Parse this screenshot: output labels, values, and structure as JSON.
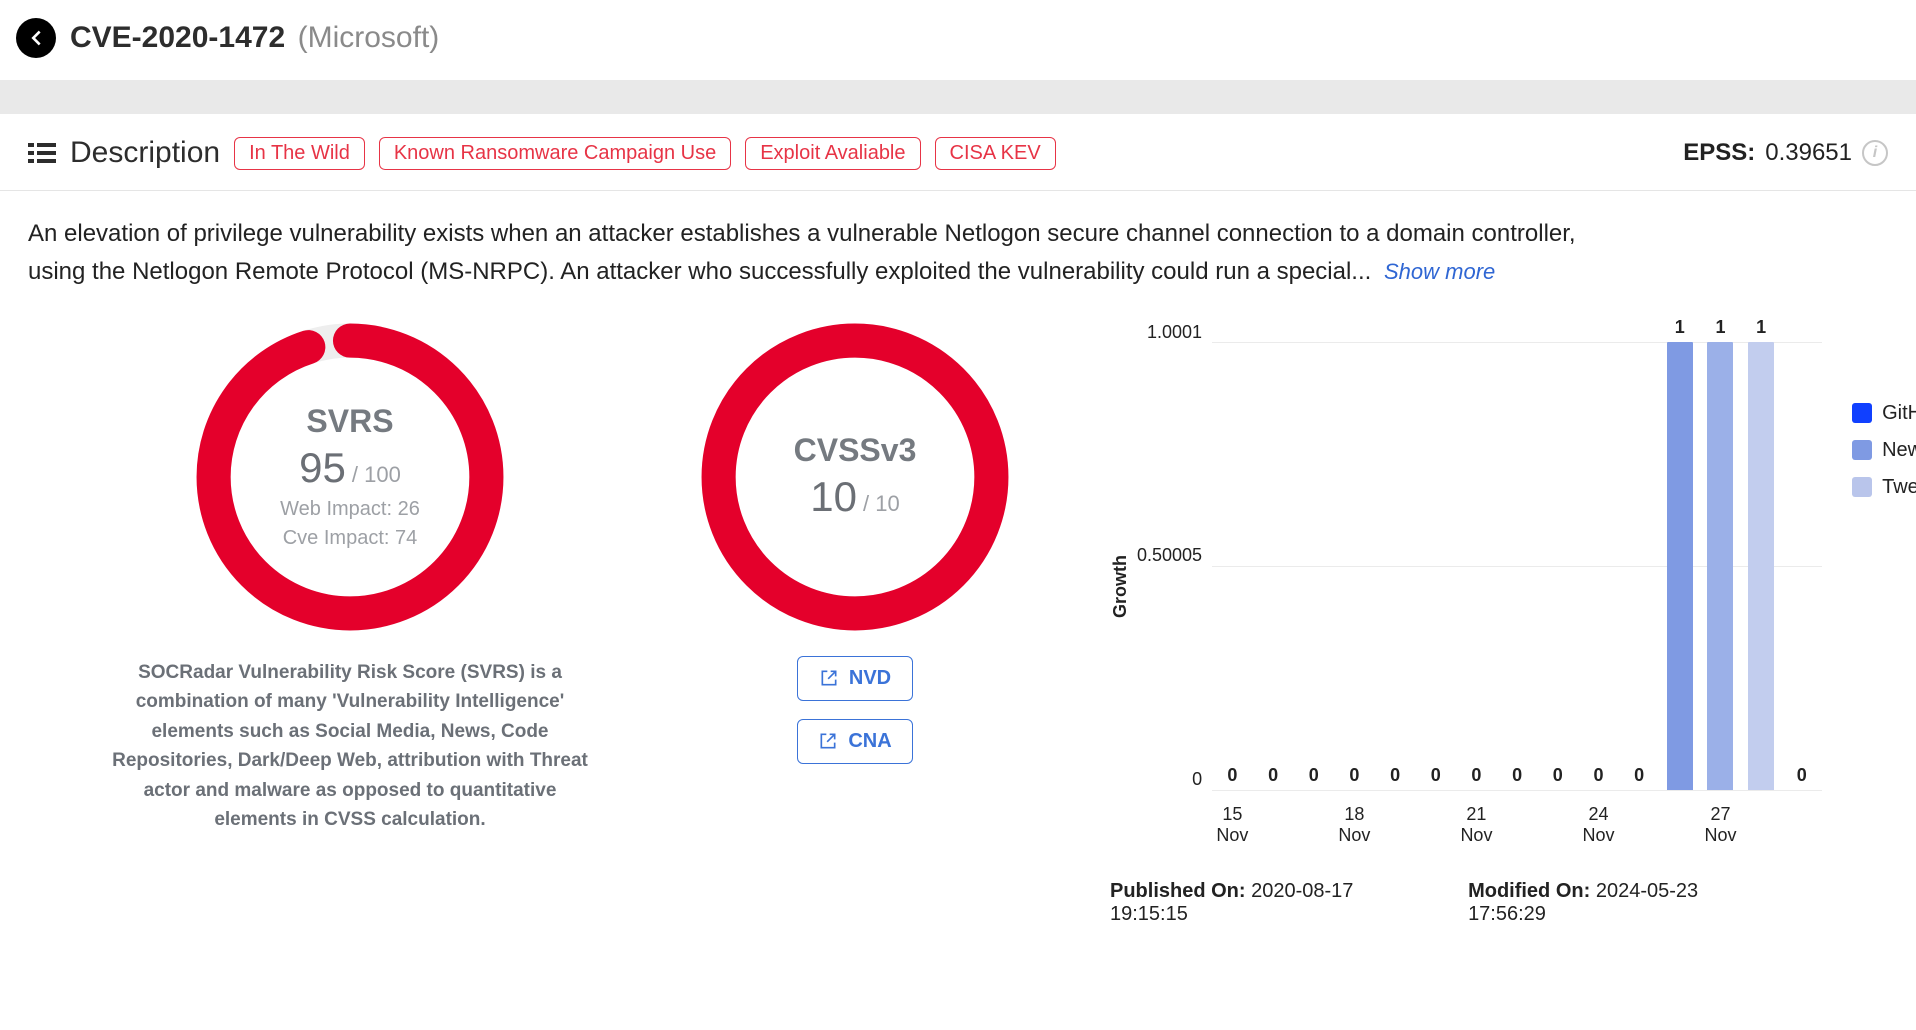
{
  "header": {
    "cve_id": "CVE-2020-1472",
    "vendor": "(Microsoft)"
  },
  "description_row": {
    "label": "Description",
    "tags": [
      "In The Wild",
      "Known Ransomware Campaign Use",
      "Exploit Avaliable",
      "CISA KEV"
    ],
    "epss_label": "EPSS:",
    "epss_value": "0.39651"
  },
  "description_text": "An elevation of privilege vulnerability exists when an attacker establishes a vulnerable Netlogon secure channel connection to a domain controller, using the Netlogon Remote Protocol (MS-NRPC). An attacker who successfully exploited the vulnerability could run a special...",
  "show_more_label": "Show more",
  "gauges": {
    "svrs": {
      "title": "SVRS",
      "score": "95",
      "max": "/ 100",
      "sub1_label": "Web Impact:",
      "sub1_value": "26",
      "sub2_label": "Cve Impact:",
      "sub2_value": "74",
      "fill_fraction": 0.95,
      "caption": "SOCRadar Vulnerability Risk Score (SVRS) is a combination of many 'Vulnerability Intelligence' elements such as Social Media, News, Code Repositories, Dark/Deep Web, attribution with Threat actor and malware as opposed to quantitative elements in CVSS calculation."
    },
    "cvss": {
      "title": "CVSSv3",
      "score": "10",
      "max": "/ 10",
      "fill_fraction": 1.0,
      "link_nvd": "NVD",
      "link_cna": "CNA"
    }
  },
  "chart_data": {
    "type": "bar",
    "title": "",
    "ylabel": "Growth",
    "y_ticks": [
      "1.0001",
      "0.50005",
      "0"
    ],
    "ylim": [
      0,
      1.0001
    ],
    "categories": [
      "15 Nov",
      "",
      "",
      "18 Nov",
      "",
      "",
      "21 Nov",
      "",
      "",
      "24 Nov",
      "",
      "",
      "27 Nov",
      "",
      ""
    ],
    "bar_labels": [
      "0",
      "0",
      "0",
      "0",
      "0",
      "0",
      "0",
      "0",
      "0",
      "0",
      "0",
      "1",
      "1",
      "1",
      "0"
    ],
    "values": [
      0,
      0,
      0,
      0,
      0,
      0,
      0,
      0,
      0,
      0,
      0,
      1,
      1,
      1,
      0
    ],
    "series_index": [
      0,
      0,
      0,
      0,
      0,
      0,
      0,
      0,
      0,
      0,
      0,
      0,
      1,
      2,
      0
    ],
    "legend": [
      {
        "name": "GitHub",
        "color": "#1040ff"
      },
      {
        "name": "News",
        "color": "#7f9ae3"
      },
      {
        "name": "Tweets",
        "color": "#b9c5eb"
      }
    ],
    "bar_colors": [
      "#7f9ae3",
      "#7f9ae3",
      "#7f9ae3",
      "#7f9ae3",
      "#7f9ae3",
      "#7f9ae3",
      "#7f9ae3",
      "#7f9ae3",
      "#7f9ae3",
      "#7f9ae3",
      "#7f9ae3",
      "#7f9ae3",
      "#9bb0e8",
      "#c2cdee",
      "#7f9ae3"
    ]
  },
  "meta": {
    "published_label": "Published On:",
    "published_value": "2020-08-17 19:15:15",
    "modified_label": "Modified On:",
    "modified_value": "2024-05-23 17:56:29"
  }
}
